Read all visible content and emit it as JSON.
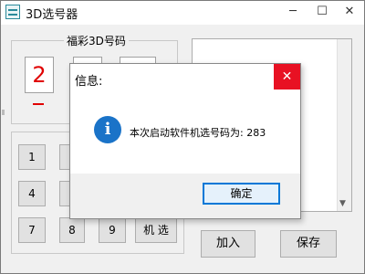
{
  "window": {
    "title": "3D选号器",
    "minimize": "─",
    "maximize": "☐",
    "close": "✕"
  },
  "group1": {
    "label": "福彩3D号码"
  },
  "digits": [
    {
      "value": "2"
    }
  ],
  "keypad": [
    {
      "label": "1"
    },
    {
      "label": "4"
    },
    {
      "label": "7"
    },
    {
      "label": "8"
    },
    {
      "label": "9"
    },
    {
      "label": "机 选"
    }
  ],
  "actions": {
    "add": "加入",
    "save": "保存"
  },
  "dialog": {
    "title": "信息:",
    "close": "✕",
    "icon": "info-icon",
    "message": "本次启动软件机选号码为: 283",
    "ok": "确定"
  },
  "colors": {
    "accent": "#0078d7",
    "digit_red": "#e00000",
    "close_red": "#e81123",
    "info_blue": "#1a73c8"
  }
}
